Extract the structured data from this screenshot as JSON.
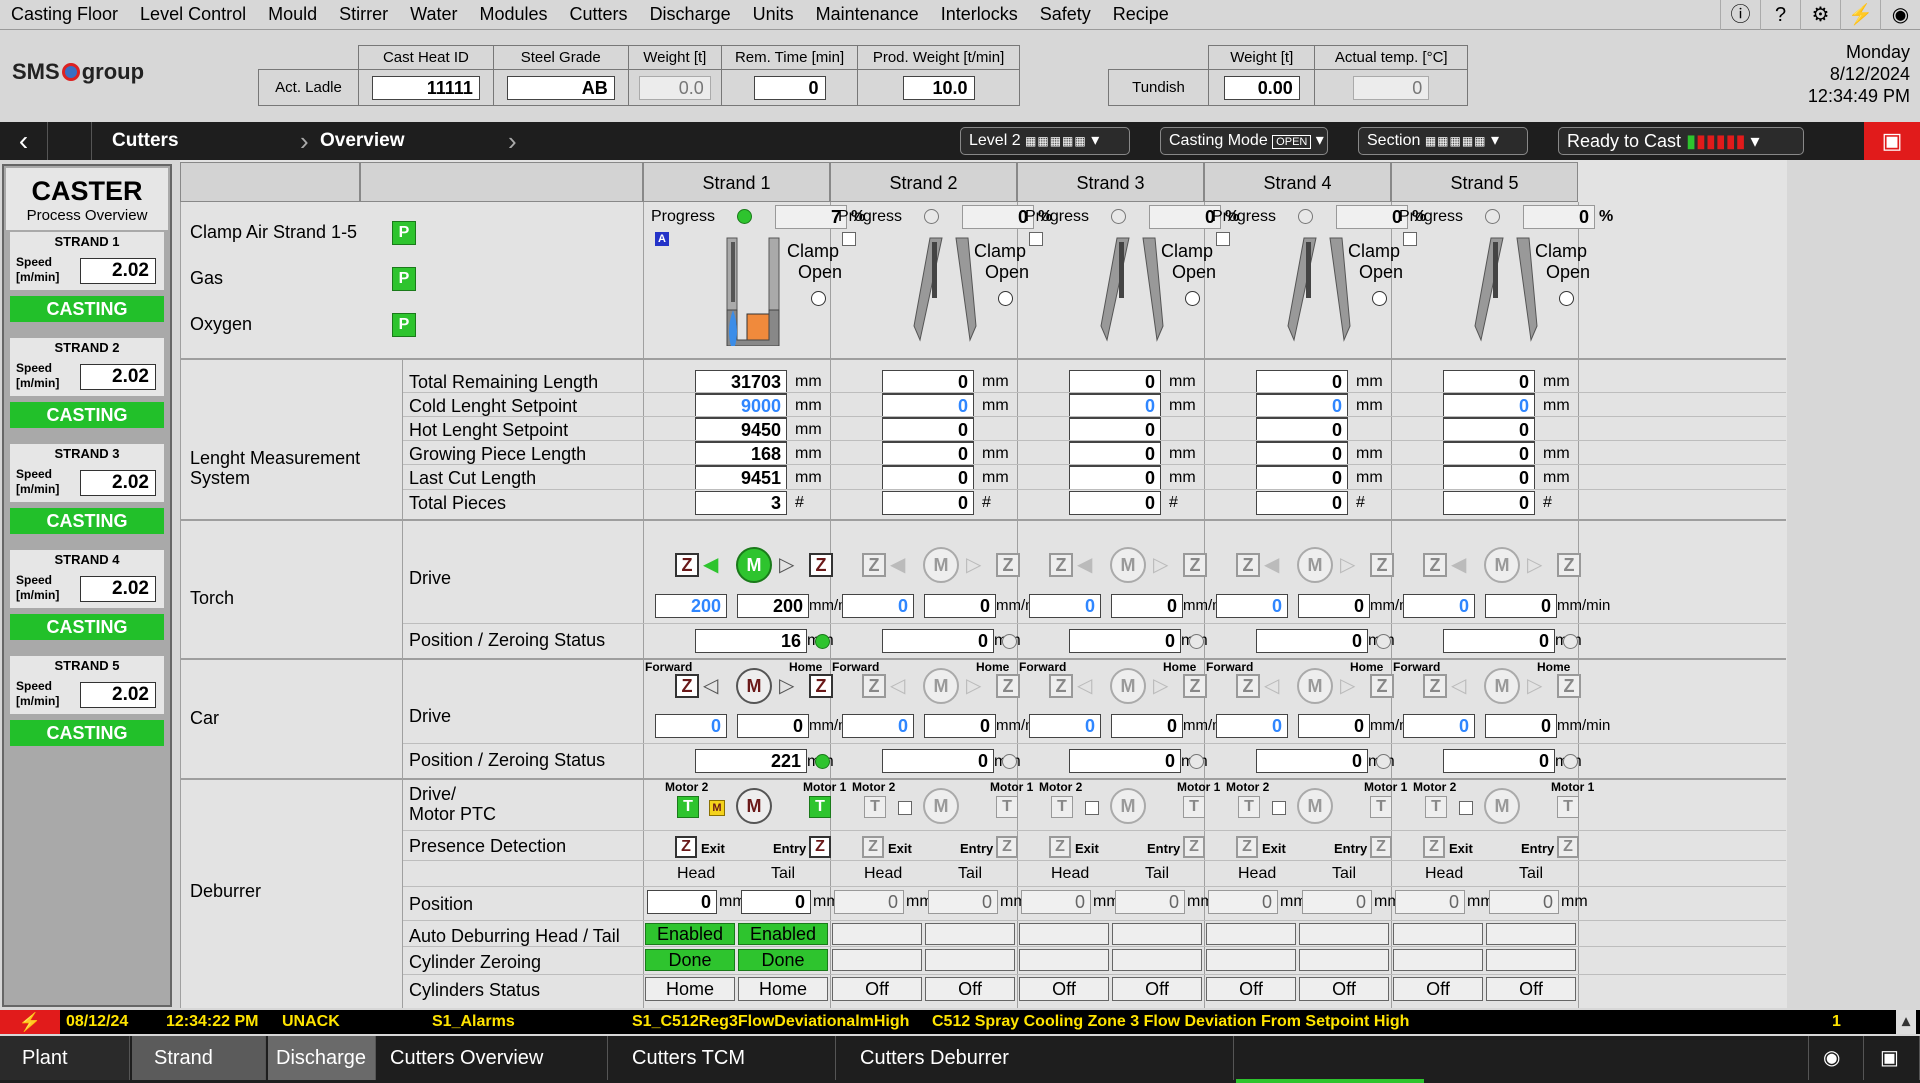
{
  "menu": [
    "Casting Floor",
    "Level Control",
    "Mould",
    "Stirrer",
    "Water",
    "Modules",
    "Cutters",
    "Discharge",
    "Units",
    "Maintenance",
    "Interlocks",
    "Safety",
    "Recipe"
  ],
  "menu_icons": [
    "info-icon",
    "help-icon",
    "settings-icon",
    "lightning-icon",
    "eye-icon"
  ],
  "logo": "SMS group",
  "ladle": {
    "row_label": "Act. Ladle",
    "cols": [
      "Cast Heat ID",
      "Steel Grade",
      "Weight [t]",
      "Rem. Time [min]",
      "Prod. Weight [t/min]"
    ],
    "values": [
      "11111",
      "AB",
      "0.0",
      "0",
      "10.0"
    ]
  },
  "tundish": {
    "row_label": "Tundish",
    "cols": [
      "Weight [t]",
      "Actual temp. [°C]"
    ],
    "values": [
      "0.00",
      "0"
    ]
  },
  "clock": {
    "day": "Monday",
    "date": "8/12/2024",
    "time": "12:34:49 PM"
  },
  "nav": {
    "crumb1": "Cutters",
    "crumb2": "Overview",
    "level": "Level 2",
    "casting_mode": "Casting Mode",
    "casting_mode_value": "OPEN",
    "section": "Section",
    "ready": "Ready to Cast"
  },
  "sidebar": {
    "title": "CASTER",
    "subtitle": "Process Overview",
    "speed_label_1": "Speed",
    "speed_label_2": "[m/min]",
    "strands": [
      {
        "name": "STRAND 1",
        "speed": "2.02",
        "status": "CASTING"
      },
      {
        "name": "STRAND 2",
        "speed": "2.02",
        "status": "CASTING"
      },
      {
        "name": "STRAND 3",
        "speed": "2.02",
        "status": "CASTING"
      },
      {
        "name": "STRAND 4",
        "speed": "2.02",
        "status": "CASTING"
      },
      {
        "name": "STRAND 5",
        "speed": "2.02",
        "status": "CASTING"
      }
    ]
  },
  "strand_headers": [
    "Strand 1",
    "Strand 2",
    "Strand 3",
    "Strand 4",
    "Strand 5"
  ],
  "top": {
    "clamp_air": "Clamp Air Strand 1-5",
    "gas": "Gas",
    "oxygen": "Oxygen",
    "p": "P",
    "progress": "Progress",
    "pct": "%",
    "clamp": "Clamp",
    "open": "Open",
    "a": "A",
    "progress_values": [
      "7",
      "0",
      "0",
      "0",
      "0"
    ]
  },
  "lms": {
    "section": "Lenght Measurement System",
    "rows": [
      {
        "label": "Total Remaining Length",
        "unit": "mm",
        "values": [
          "31703",
          "0",
          "0",
          "0",
          "0"
        ]
      },
      {
        "label": "Cold Lenght Setpoint",
        "unit": "mm",
        "values": [
          "9000",
          "0",
          "0",
          "0",
          "0"
        ]
      },
      {
        "label": "Hot Lenght Setpoint",
        "unit": "mm",
        "values": [
          "9450",
          "0",
          "0",
          "0",
          "0"
        ]
      },
      {
        "label": "Growing Piece Length",
        "unit": "mm",
        "values": [
          "168",
          "0",
          "0",
          "0",
          "0"
        ]
      },
      {
        "label": "Last Cut Length",
        "unit": "mm",
        "values": [
          "9451",
          "0",
          "0",
          "0",
          "0"
        ]
      },
      {
        "label": "Total Pieces",
        "unit": "#",
        "values": [
          "3",
          "0",
          "0",
          "0",
          "0"
        ]
      }
    ]
  },
  "torch": {
    "section": "Torch",
    "drive": "Drive",
    "pos": "Position / Zeroing Status",
    "z": "Z",
    "m": "M",
    "unit_speed": "mm/min",
    "unit_mm": "mm",
    "set": [
      "200",
      "0",
      "0",
      "0",
      "0"
    ],
    "act": [
      "200",
      "0",
      "0",
      "0",
      "0"
    ],
    "pos_values": [
      "16",
      "0",
      "0",
      "0",
      "0"
    ]
  },
  "car": {
    "section": "Car",
    "drive": "Drive",
    "pos": "Position / Zeroing Status",
    "forward": "Forward",
    "home": "Home",
    "set": [
      "0",
      "0",
      "0",
      "0",
      "0"
    ],
    "act": [
      "0",
      "0",
      "0",
      "0",
      "0"
    ],
    "pos_values": [
      "221",
      "0",
      "0",
      "0",
      "0"
    ]
  },
  "deburrer": {
    "section": "Deburrer",
    "drive": "Drive/",
    "motor_ptc": "Motor PTC",
    "presence": "Presence Detection",
    "motor2": "Motor 2",
    "motor1": "Motor 1",
    "t": "T",
    "mbadge": "M",
    "exit": "Exit",
    "entry": "Entry",
    "head": "Head",
    "tail": "Tail",
    "position": "Position",
    "auto": "Auto Deburring Head / Tail",
    "cyl_zero": "Cylinder Zeroing",
    "cyl_status": "Cylinders Status",
    "pos_head": [
      "0",
      "0",
      "0",
      "0",
      "0"
    ],
    "pos_tail": [
      "0",
      "0",
      "0",
      "0",
      "0"
    ],
    "auto_head": [
      "Enabled",
      "",
      "",
      "",
      ""
    ],
    "auto_tail": [
      "Enabled",
      "",
      "",
      "",
      ""
    ],
    "zero_head": [
      "Done",
      "",
      "",
      "",
      ""
    ],
    "zero_tail": [
      "Done",
      "",
      "",
      "",
      ""
    ],
    "status_head": [
      "Home",
      "Off",
      "Off",
      "Off",
      "Off"
    ],
    "status_tail": [
      "Home",
      "Off",
      "Off",
      "Off",
      "Off"
    ]
  },
  "alarm": {
    "date": "08/12/24",
    "time": "12:34:22 PM",
    "state": "UNACK",
    "group": "S1_Alarms",
    "tag": "S1_C512Reg3FlowDeviationalmHigh",
    "message": "C512 Spray Cooling Zone 3 Flow Deviation From Setpoint High",
    "count": "1"
  },
  "bottom": [
    "Plant",
    "Strand",
    "Discharge",
    "Cutters Overview",
    "Cutters TCM",
    "Cutters Deburrer"
  ],
  "colors": {
    "green": "#2ec42e",
    "blue_value": "#2f86ff",
    "alarm_text": "#ffe400",
    "red_icon": "#e11b1b"
  }
}
